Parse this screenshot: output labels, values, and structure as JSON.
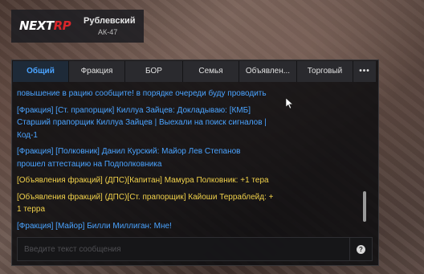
{
  "player": {
    "logo_main": "NEXT",
    "logo_accent": "RP",
    "name": "Рублевский",
    "weapon": "АК-47"
  },
  "chat": {
    "tabs": [
      "Общий",
      "Фракция",
      "БОР",
      "Семья",
      "Объявлен...",
      "Торговый"
    ],
    "more_label": "•••",
    "messages": [
      {
        "text": "повышение в рацию сообщите! в порядке очереди буду проводить",
        "color": "#4aa3ff"
      },
      {
        "text": "[Фракция] [Ст. прапорщик] Киллуа Зайцев: Докладываю: [КМБ]\nСтарший прапорщик Киллуа Зайцев | Выехали на поиск сигналов |\nКод-1",
        "color": "#4aa3ff"
      },
      {
        "text": "[Фракция] [Полковник] Данил Курский: Майор Лев Степанов\nпрошел аттестацию на Подполковника",
        "color": "#4aa3ff"
      },
      {
        "text": "[Объявления фракций] (ДПС)[Капитан] Мамура Полковник: +1 тера",
        "color": "#f2d24b"
      },
      {
        "text": "[Объявления фракций] (ДПС)[Ст. прапорщик] Кайоши Терраблейд: +\n1 терра",
        "color": "#f2d24b"
      },
      {
        "text": "[Фракция] [Майор] Билли Миллиган: Мне!",
        "color": "#4aa3ff"
      }
    ],
    "input_placeholder": "Введите текст сообщения",
    "help_label": "?"
  }
}
